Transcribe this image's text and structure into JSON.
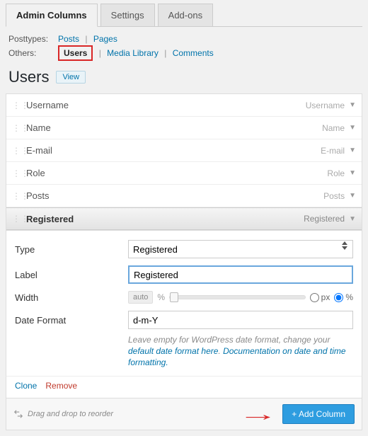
{
  "tabs": {
    "admin": "Admin Columns",
    "settings": "Settings",
    "addons": "Add-ons"
  },
  "filters": {
    "posttypes_label": "Posttypes:",
    "others_label": "Others:",
    "posts": "Posts",
    "pages": "Pages",
    "users": "Users",
    "media": "Media Library",
    "comments": "Comments"
  },
  "heading": {
    "title": "Users",
    "view": "View"
  },
  "columns": [
    {
      "name": "Username",
      "type": "Username"
    },
    {
      "name": "Name",
      "type": "Name"
    },
    {
      "name": "E-mail",
      "type": "E-mail"
    },
    {
      "name": "Role",
      "type": "Role"
    },
    {
      "name": "Posts",
      "type": "Posts"
    },
    {
      "name": "Registered",
      "type": "Registered"
    }
  ],
  "form": {
    "type_label": "Type",
    "type_value": "Registered",
    "label_label": "Label",
    "label_value": "Registered",
    "width_label": "Width",
    "width_auto": "auto",
    "width_pct": "%",
    "unit_px": "px",
    "unit_pct": "%",
    "dateformat_label": "Date Format",
    "dateformat_value": "d-m-Y",
    "helper_pre": "Leave empty for WordPress date format, change your ",
    "helper_link1": "default date format here",
    "helper_mid": ". ",
    "helper_link2": "Documentation on date and time formatting.",
    "clone": "Clone",
    "remove": "Remove"
  },
  "footer": {
    "reorder": "Drag and drop to reorder",
    "add": "+ Add Column"
  }
}
